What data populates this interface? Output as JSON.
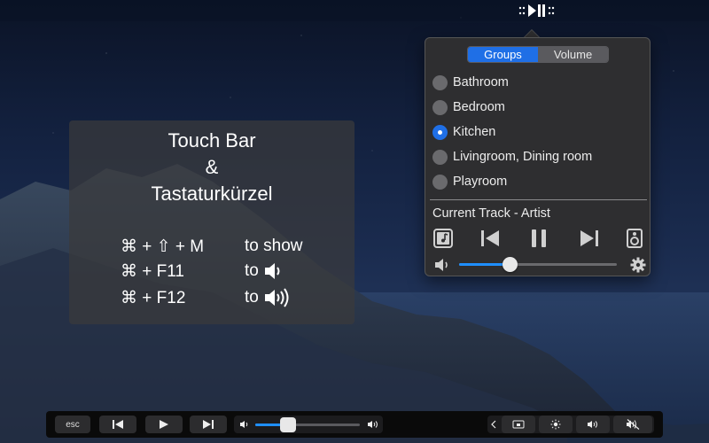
{
  "menubar": {
    "icon": "play-pause-menubar-icon"
  },
  "popover": {
    "tabs": [
      {
        "label": "Groups",
        "active": true
      },
      {
        "label": "Volume",
        "active": false
      }
    ],
    "groups": [
      {
        "label": "Bathroom",
        "selected": false
      },
      {
        "label": "Bedroom",
        "selected": false
      },
      {
        "label": "Kitchen",
        "selected": true
      },
      {
        "label": "Livingroom, Dining room",
        "selected": false
      },
      {
        "label": "Playroom",
        "selected": false
      }
    ],
    "current_track": "Current Track - Artist",
    "volume_level": 0.32,
    "colors": {
      "accent": "#1f6fe6",
      "background": "#2e2e30"
    }
  },
  "info_panel": {
    "title_line1": "Touch Bar",
    "title_line2": "&",
    "title_line3": "Tastaturkürzel",
    "shortcuts": [
      {
        "keys": "⌘ + ⇧ + M",
        "action": "to show",
        "icon": ""
      },
      {
        "keys": "⌘ + F11",
        "action": "to",
        "icon": "speaker-low-icon"
      },
      {
        "keys": "⌘ + F12",
        "action": "to",
        "icon": "speaker-high-icon"
      }
    ]
  },
  "touchbar": {
    "esc_label": "esc",
    "volume_level": 0.31
  }
}
